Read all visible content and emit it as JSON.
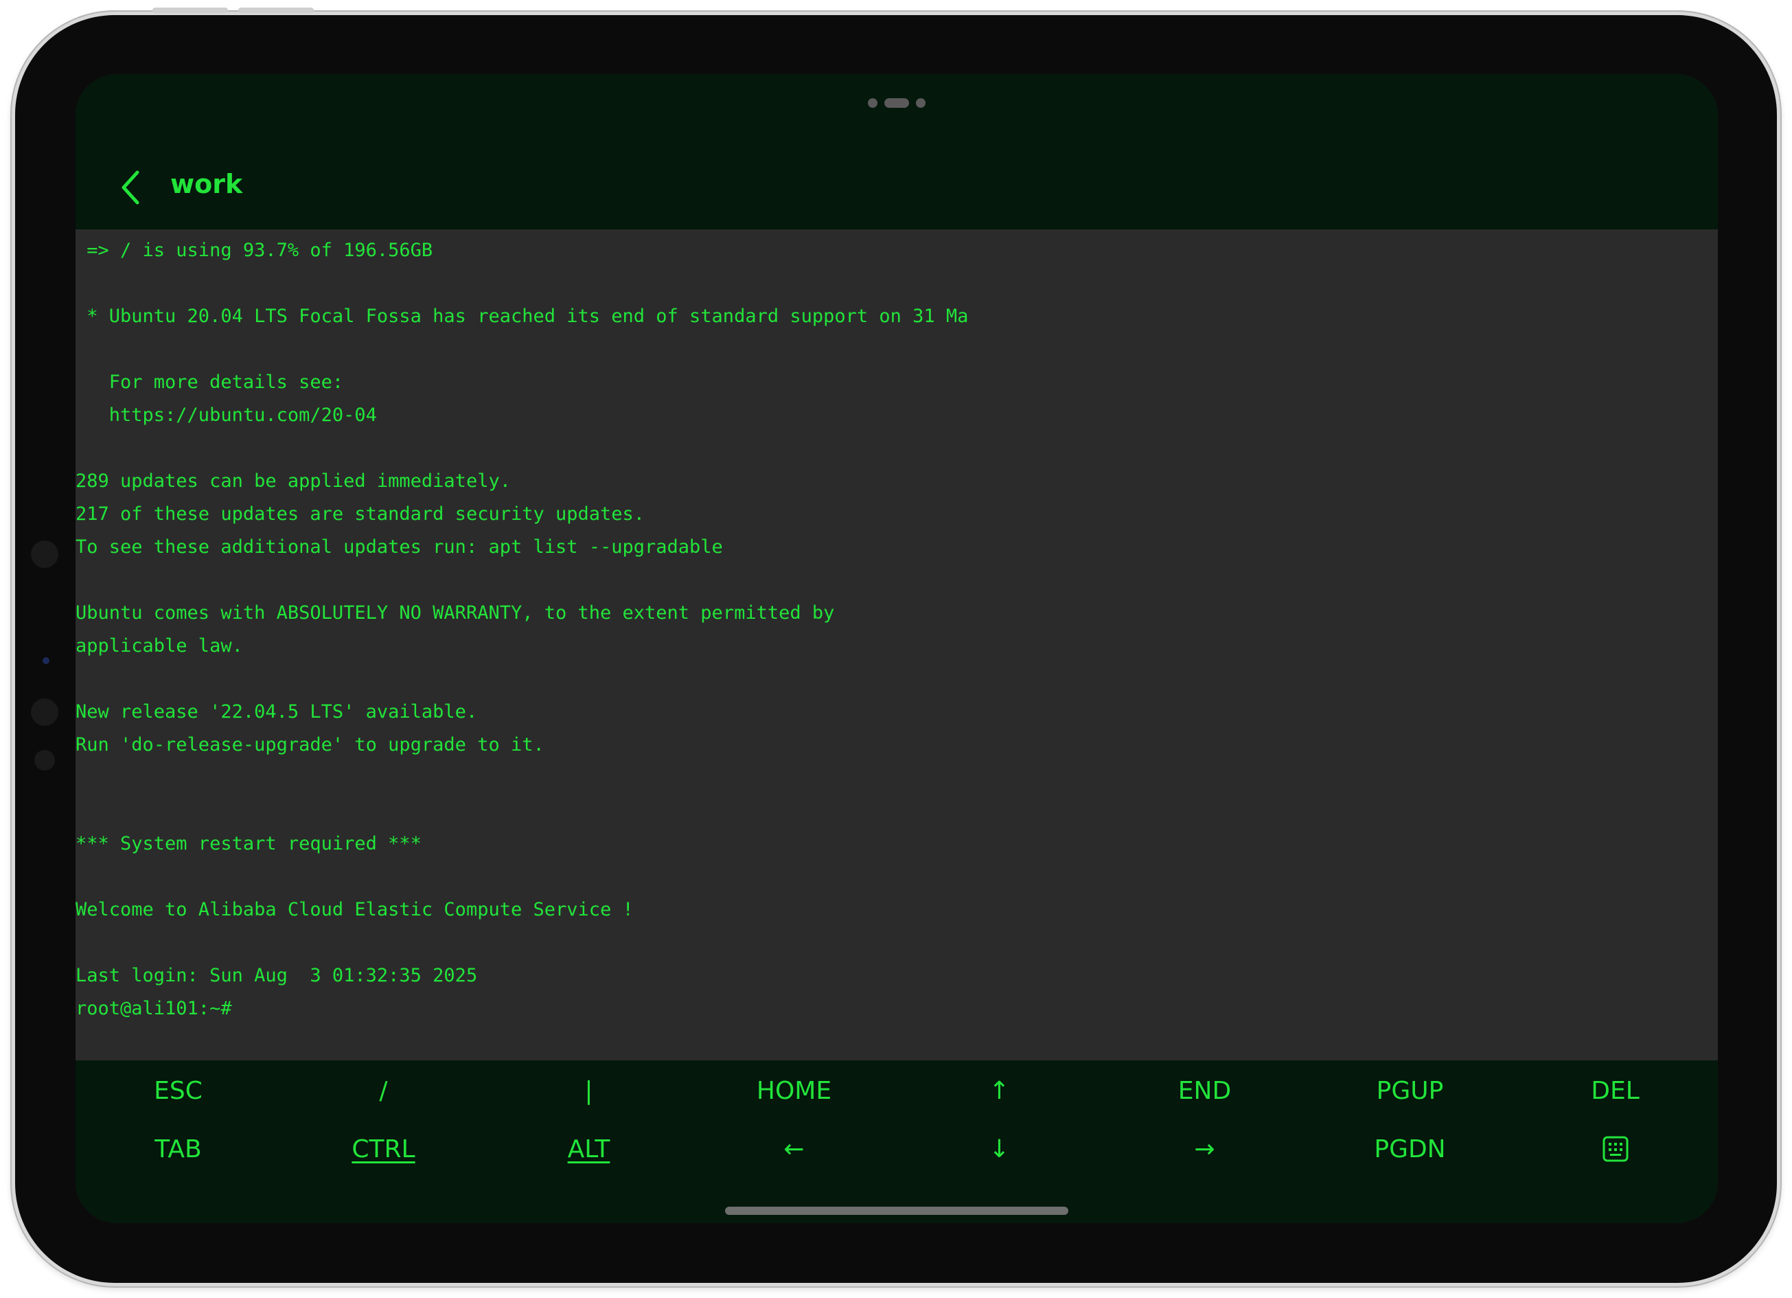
{
  "header": {
    "title": "work",
    "back_icon": "chevron-left-icon"
  },
  "terminal": {
    "lines": [
      " => / is using 93.7% of 196.56GB",
      "",
      " * Ubuntu 20.04 LTS Focal Fossa has reached its end of standard support on 31 Ma",
      "",
      "   For more details see:",
      "   https://ubuntu.com/20-04",
      "",
      "289 updates can be applied immediately.",
      "217 of these updates are standard security updates.",
      "To see these additional updates run: apt list --upgradable",
      "",
      "Ubuntu comes with ABSOLUTELY NO WARRANTY, to the extent permitted by",
      "applicable law.",
      "",
      "New release '22.04.5 LTS' available.",
      "Run 'do-release-upgrade' to upgrade to it.",
      "",
      "",
      "*** System restart required ***",
      "",
      "Welcome to Alibaba Cloud Elastic Compute Service !",
      "",
      "Last login: Sun Aug  3 01:32:35 2025",
      "root@ali101:~#"
    ]
  },
  "keybar": {
    "row1": [
      "ESC",
      "/",
      "|",
      "HOME",
      "↑",
      "END",
      "PGUP",
      "DEL"
    ],
    "row2": [
      "TAB",
      "CTRL",
      "ALT",
      "←",
      "↓",
      "→",
      "PGDN"
    ],
    "keyboard_icon": "keyboard-icon"
  },
  "colors": {
    "accent": "#22e43a",
    "header_bg": "#04180c",
    "terminal_bg": "#2b2b2b"
  }
}
